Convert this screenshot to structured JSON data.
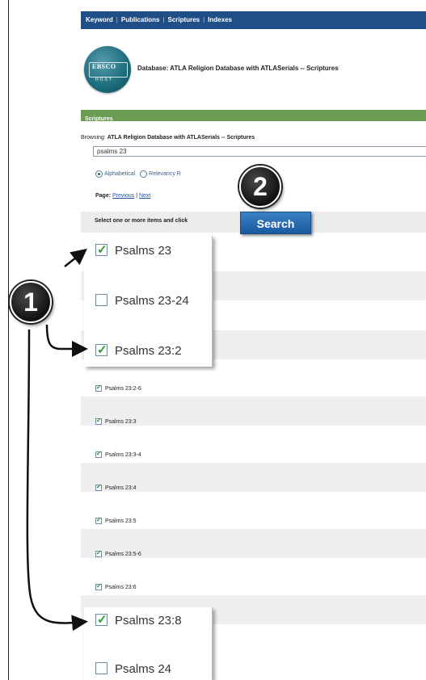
{
  "topnav": {
    "links": [
      "Keyword",
      "Publications",
      "Scriptures",
      "Indexes"
    ],
    "separator": "|"
  },
  "logo": {
    "brand": "EBSCO",
    "sub": "HOST"
  },
  "database_title": "Database: ATLA Religion Database with ATLASerials -- Scriptures",
  "section_title": "Scriptures",
  "browsing": {
    "label": "Browsing:",
    "value": "ATLA Religion Database with ATLASerials -- Scriptures"
  },
  "search": {
    "value": "psalms 23"
  },
  "sort_options": [
    {
      "label": "Alphabetical",
      "selected": true
    },
    {
      "label": "Relevancy R",
      "selected": false
    }
  ],
  "pager": {
    "label": "Page:",
    "previous": "Previous",
    "next": "Next",
    "separator": "|"
  },
  "select_instruction": "Select one or more items and click",
  "search_button": "Search",
  "callouts": {
    "one": "1",
    "two": "2"
  },
  "zoomed_top": [
    {
      "label": "Psalms 23",
      "checked": true
    },
    {
      "label": "Psalms 23-24",
      "checked": false
    },
    {
      "label": "Psalms 23:2",
      "checked": true
    }
  ],
  "small_items": [
    {
      "label": "Psalms 23:2-6",
      "checked": true
    },
    {
      "label": "Psalms 23:3",
      "checked": true
    },
    {
      "label": "Psalms 23:3-4",
      "checked": true
    },
    {
      "label": "Psalms 23:4",
      "checked": true
    },
    {
      "label": "Psalms 23:5",
      "checked": true
    },
    {
      "label": "Psalms 23:5-6",
      "checked": true
    },
    {
      "label": "Psalms 23:6",
      "checked": true
    }
  ],
  "zoomed_bottom": [
    {
      "label": "Psalms 23:8",
      "checked": true
    },
    {
      "label": "Psalms 24",
      "checked": false
    }
  ],
  "colors": {
    "nav": "#1f4f86",
    "section": "#6b9c54",
    "button": "#1b5aa0",
    "check": "#2e9b2e"
  }
}
